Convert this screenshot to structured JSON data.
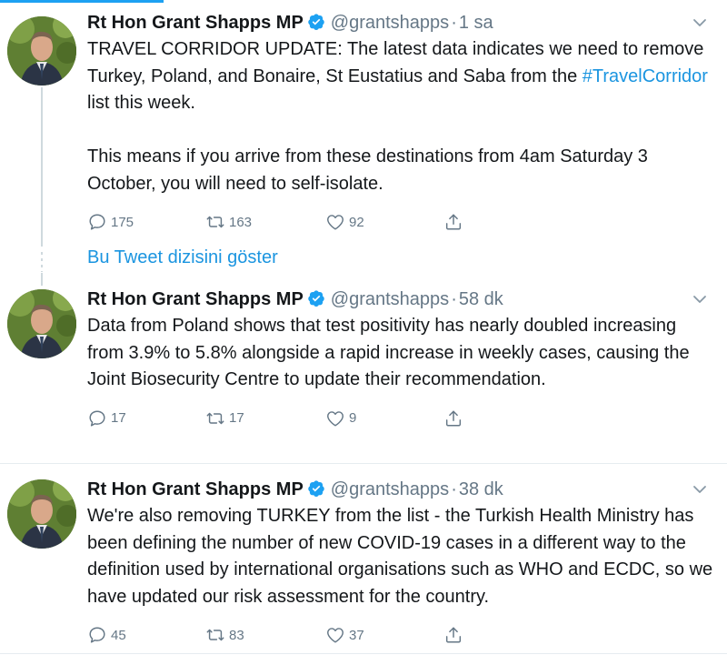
{
  "colors": {
    "accent": "#1da1f2",
    "link": "#1b95e0",
    "muted": "#657786",
    "text": "#14171a"
  },
  "show_thread_link": "Bu Tweet dizisini göster",
  "tweets": [
    {
      "name": "Rt Hon Grant Shapps MP",
      "handle": "@grantshapps",
      "time": "1 sa",
      "text_before_tag": "TRAVEL CORRIDOR UPDATE: The latest data indicates we need to remove Turkey, Poland, and Bonaire, St Eustatius and Saba from the ",
      "hashtag": "#TravelCorridor",
      "text_after_tag": " list this week.\n\nThis means if you arrive from these destinations from 4am Saturday 3 October, you will need to self-isolate.",
      "replies": "175",
      "retweets": "163",
      "likes": "92"
    },
    {
      "name": "Rt Hon Grant Shapps MP",
      "handle": "@grantshapps",
      "time": "58 dk",
      "text": "Data from Poland shows that test positivity has nearly doubled increasing from 3.9% to 5.8% alongside a rapid increase in weekly cases, causing the Joint Biosecurity Centre to update their recommendation.",
      "replies": "17",
      "retweets": "17",
      "likes": "9"
    },
    {
      "name": "Rt Hon Grant Shapps MP",
      "handle": "@grantshapps",
      "time": "38 dk",
      "text": "We're also removing TURKEY from the list - the Turkish Health Ministry has been defining the number of new COVID-19 cases in a different way to the definition used by international organisations such as WHO and ECDC, so we have updated our risk assessment for the country.",
      "replies": "45",
      "retweets": "83",
      "likes": "37"
    }
  ]
}
